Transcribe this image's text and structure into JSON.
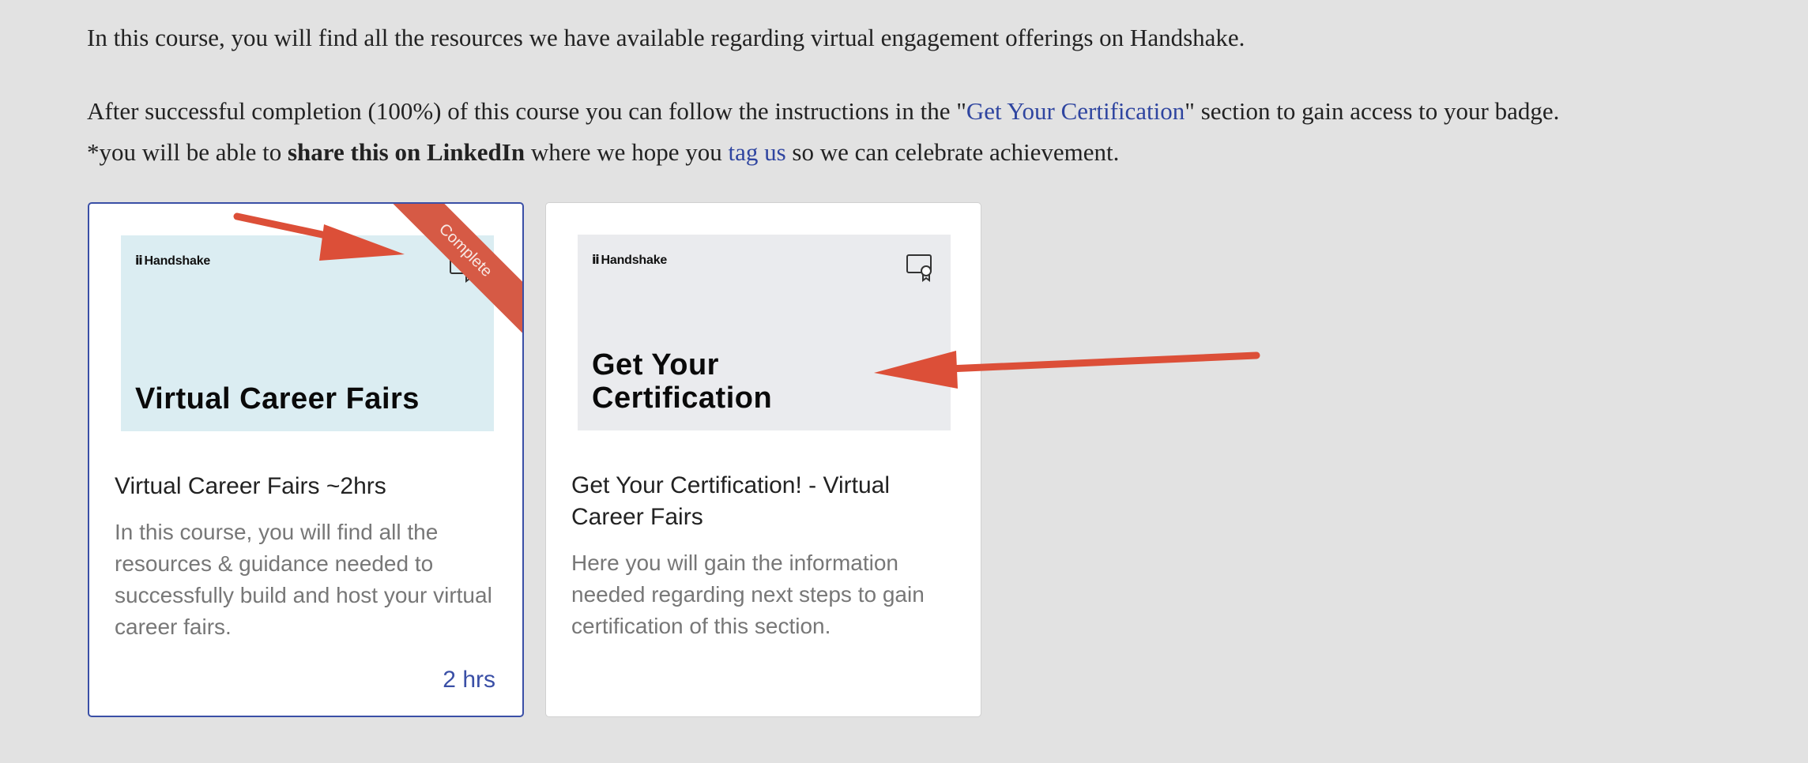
{
  "intro": {
    "line1": "In this course, you will find all the resources we have available regarding virtual engagement offerings on Handshake.",
    "line2_before": "After successful completion (100%) of this course you can follow the instructions in the \"",
    "line2_link": "Get Your Certification",
    "line2_after": "\" section to gain access to your badge.",
    "line3_before": "*you will be able to ",
    "line3_bold": "share this on LinkedIn",
    "line3_middle": " where we hope you ",
    "line3_link": "tag us",
    "line3_after": " so we can celebrate achievement."
  },
  "cards": [
    {
      "brand": "Handshake",
      "thumb_title": "Virtual Career Fairs",
      "ribbon": "Complete",
      "title": "Virtual Career Fairs ~2hrs",
      "description": "In this course, you will find all the resources & guidance needed to successfully build and host your virtual career fairs.",
      "duration": "2 hrs",
      "icon": "certificate-icon"
    },
    {
      "brand": "Handshake",
      "thumb_title_line1": "Get Your",
      "thumb_title_line2": "Certification",
      "title": "Get Your Certification! - Virtual Career Fairs",
      "description": "Here you will gain the information needed regarding next steps to gain certification of this section.",
      "icon": "certificate-icon"
    }
  ],
  "colors": {
    "background": "#e2e2e2",
    "link": "#2f45a0",
    "selected_border": "#3a4fa6",
    "ribbon": "#d65a45",
    "annotation_arrow": "#dc4f38",
    "thumb_blue": "#dbedf2",
    "thumb_grey": "#eaebee"
  }
}
